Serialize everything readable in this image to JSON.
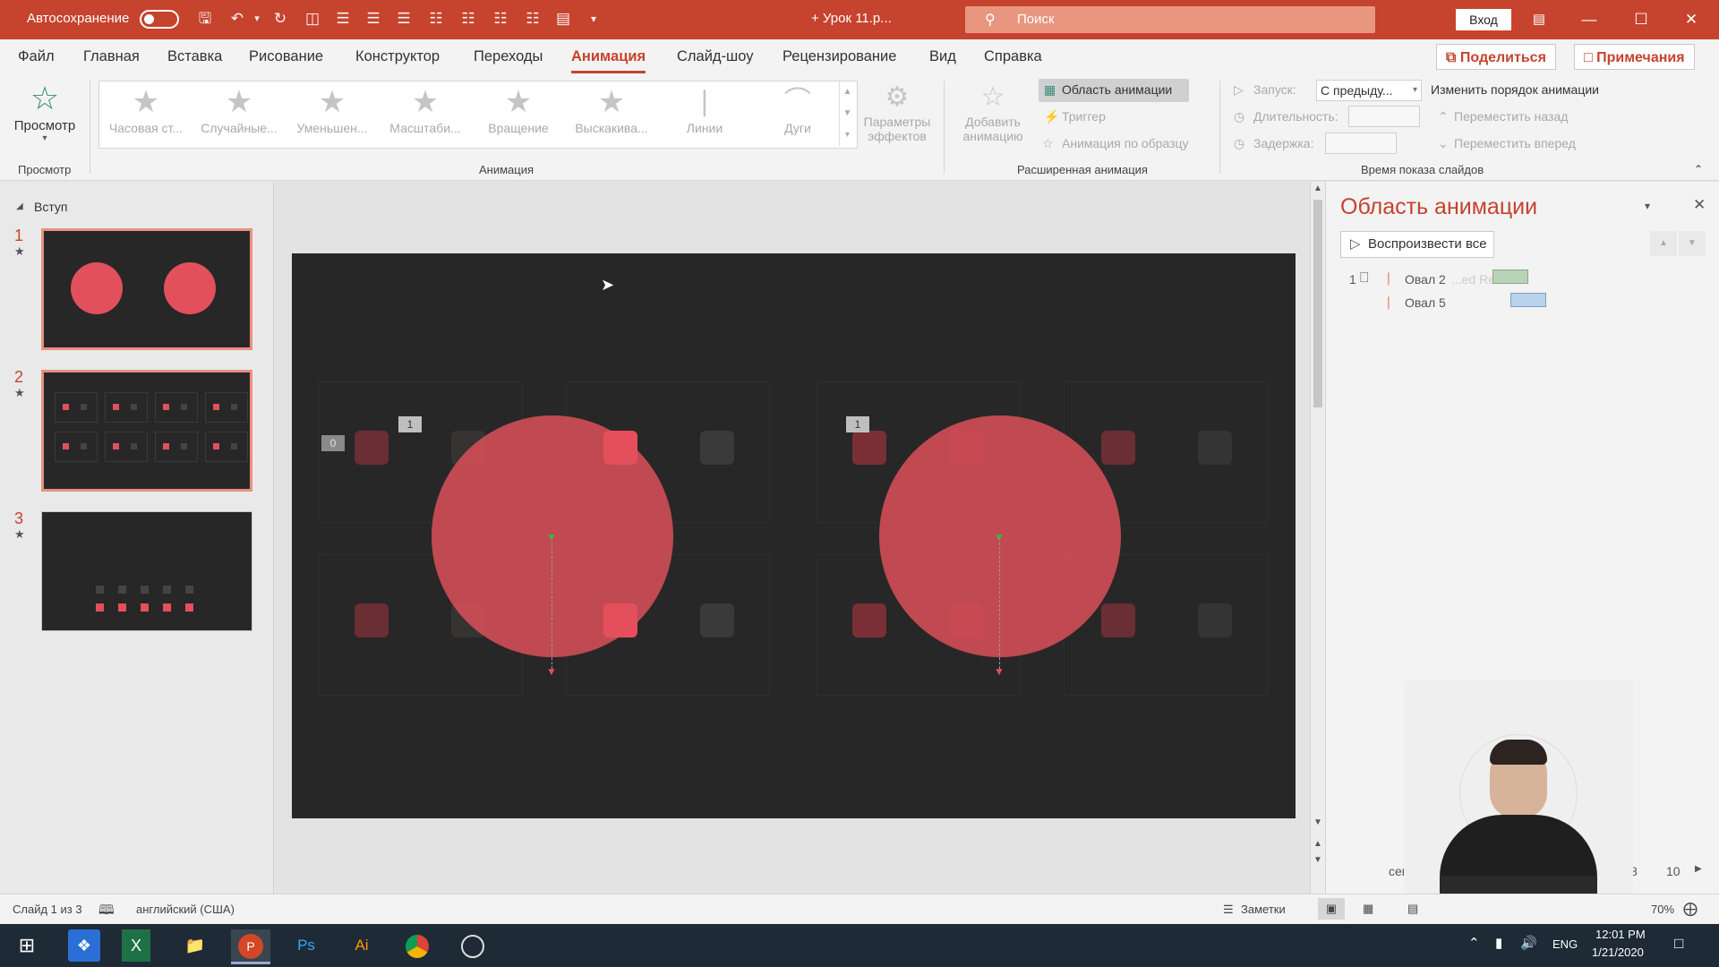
{
  "titlebar": {
    "autosave_label": "Автосохранение",
    "doc_title": "+ Урок 11.p...",
    "search_placeholder": "Поиск",
    "signin_label": "Вход",
    "accent_color": "#c6432e"
  },
  "menu": {
    "items": [
      "Файл",
      "Главная",
      "Вставка",
      "Рисование",
      "Конструктор",
      "Переходы",
      "Анимация",
      "Слайд-шоу",
      "Рецензирование",
      "Вид",
      "Справка"
    ],
    "active": "Анимация",
    "share_label": "Поделиться",
    "comments_label": "Примечания"
  },
  "ribbon": {
    "preview": {
      "label": "Просмотр",
      "group_label": "Просмотр"
    },
    "animations": [
      {
        "label": "Часовая ст...",
        "icon": "star-icon"
      },
      {
        "label": "Случайные...",
        "icon": "star-icon"
      },
      {
        "label": "Уменьшен...",
        "icon": "star-icon"
      },
      {
        "label": "Масштаби...",
        "icon": "star-icon"
      },
      {
        "label": "Вращение",
        "icon": "star-icon"
      },
      {
        "label": "Выскакива...",
        "icon": "star-icon"
      },
      {
        "label": "Линии",
        "icon": "line-path-icon"
      },
      {
        "label": "Дуги",
        "icon": "arc-path-icon"
      }
    ],
    "effect_options": {
      "line1": "Параметры",
      "line2": "эффектов"
    },
    "animation_group_label": "Анимация",
    "add_animation": {
      "line1": "Добавить",
      "line2": "анимацию"
    },
    "animation_pane_btn": "Область анимации",
    "trigger": "Триггер",
    "animation_painter": "Анимация по образцу",
    "advanced_group_label": "Расширенная анимация",
    "start_label": "Запуск:",
    "start_value": "С предыду...",
    "duration_label": "Длительность:",
    "delay_label": "Задержка:",
    "reorder_label": "Изменить порядок анимации",
    "move_back": "Переместить назад",
    "move_forward": "Переместить вперед",
    "timing_group_label": "Время показа слайдов"
  },
  "slides": {
    "section_label": "Вступ",
    "items": [
      {
        "num": "1"
      },
      {
        "num": "2"
      },
      {
        "num": "3"
      }
    ]
  },
  "slide": {
    "tags": [
      "0",
      "1",
      "1"
    ]
  },
  "pane": {
    "title": "Область анимации",
    "play_all": "Воспроизвести все",
    "rows": [
      {
        "index": "1",
        "name": "Овал 2",
        "ghost": "...ed Re...",
        "bar_color": "#b9d3b6"
      },
      {
        "index": "",
        "name": "Овал 5",
        "bar_color": "#b9d3ea"
      }
    ],
    "seconds_label": "сек",
    "timeline_a": "8",
    "timeline_b": "10"
  },
  "status": {
    "slide_info": "Слайд 1 из 3",
    "language": "английский (США)",
    "notes": "Заметки",
    "zoom": "70%"
  },
  "taskbar": {
    "lang": "ENG",
    "time": "12:01 PM",
    "date": "1/21/2020"
  }
}
